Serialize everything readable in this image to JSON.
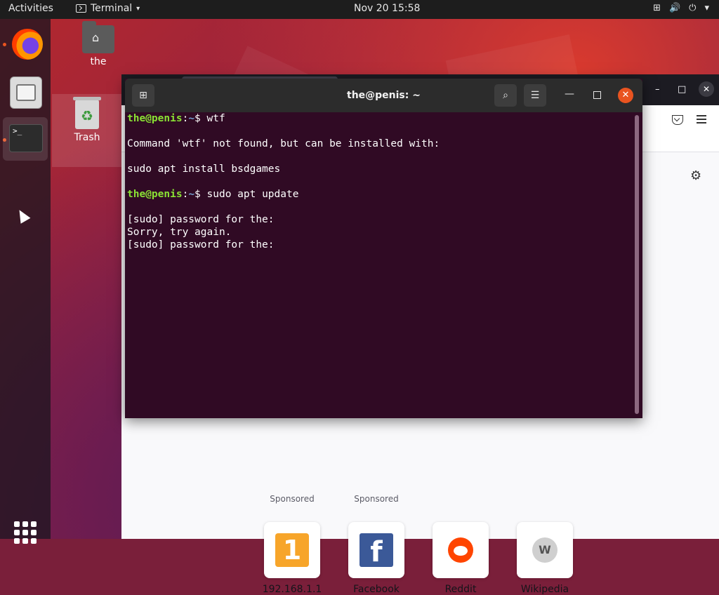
{
  "topbar": {
    "activities": "Activities",
    "app_name": "Terminal",
    "caret": "▾",
    "clock": "Nov 20  15:58",
    "tray_network": "⊞",
    "tray_volume": "🔊",
    "tray_power": "⏻",
    "tray_caret": "▾"
  },
  "desktop": {
    "home_folder_label": "the",
    "trash_label": "Trash"
  },
  "dock": {
    "terminal_glyph": ">_",
    "items": [
      "firefox",
      "files",
      "terminal"
    ]
  },
  "terminal": {
    "title": "the@penis: ~",
    "new_tab_glyph": "⊞",
    "search_glyph": "⌕",
    "menu_glyph": "☰",
    "minimize_glyph": "—",
    "close_glyph": "✕",
    "lines": [
      {
        "user": "the@penis",
        "sep": ":",
        "path": "~",
        "cmd": "$ wtf"
      },
      {
        "text": ""
      },
      {
        "text": "Command 'wtf' not found, but can be installed with:"
      },
      {
        "text": ""
      },
      {
        "text": "sudo apt install bsdgames"
      },
      {
        "text": ""
      },
      {
        "user": "the@penis",
        "sep": ":",
        "path": "~",
        "cmd": "$ sudo apt update"
      },
      {
        "text": ""
      },
      {
        "text": "[sudo] password for the:"
      },
      {
        "text": "Sorry, try again."
      },
      {
        "text": "[sudo] password for the:"
      }
    ]
  },
  "firefox": {
    "minimize_glyph": "–",
    "maximize_glyph": "□",
    "close_glyph": "✕",
    "sponsored": [
      "Sponsored",
      "Sponsored"
    ],
    "shortcuts": [
      {
        "label": "192.168.1.1",
        "glyph": "1"
      },
      {
        "label": "Facebook",
        "glyph": "f"
      },
      {
        "label": "Reddit",
        "glyph": ""
      },
      {
        "label": "Wikipedia",
        "glyph": "W"
      }
    ]
  },
  "colors": {
    "terminal_bg": "#300a24",
    "prompt_user": "#8ae234",
    "prompt_path": "#729fcf",
    "accent": "#e95420"
  }
}
